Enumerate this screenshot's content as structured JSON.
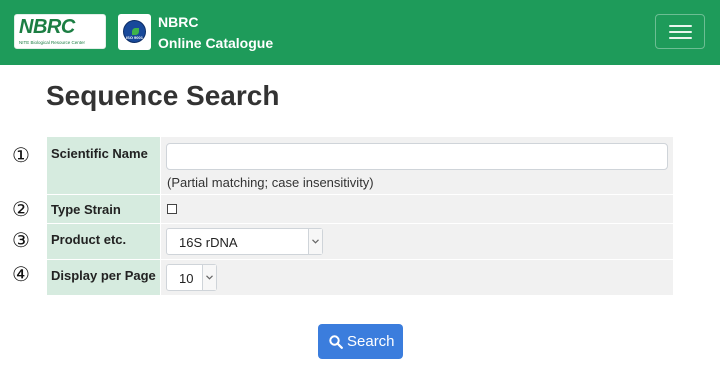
{
  "header": {
    "logo_text": "NBRC",
    "logo_subtext": "NITE Biological Resource Center",
    "iso_badge_text": "ISO 9001",
    "brand_line1": "NBRC",
    "brand_line2": "Online Catalogue",
    "brand_color": "#1e9b5a"
  },
  "page": {
    "title": "Sequence Search"
  },
  "form": {
    "markers": [
      "①",
      "②",
      "③",
      "④"
    ],
    "scientific_name": {
      "label": "Scientific Name",
      "value": "",
      "hint": "(Partial matching; case insensitivity)"
    },
    "type_strain": {
      "label": "Type Strain",
      "checked": false
    },
    "product": {
      "label": "Product etc.",
      "selected": "16S rDNA"
    },
    "display_per_page": {
      "label": "Display per Page",
      "selected": "10"
    }
  },
  "search_button": {
    "label": "Search",
    "color": "#3b7ddd"
  }
}
